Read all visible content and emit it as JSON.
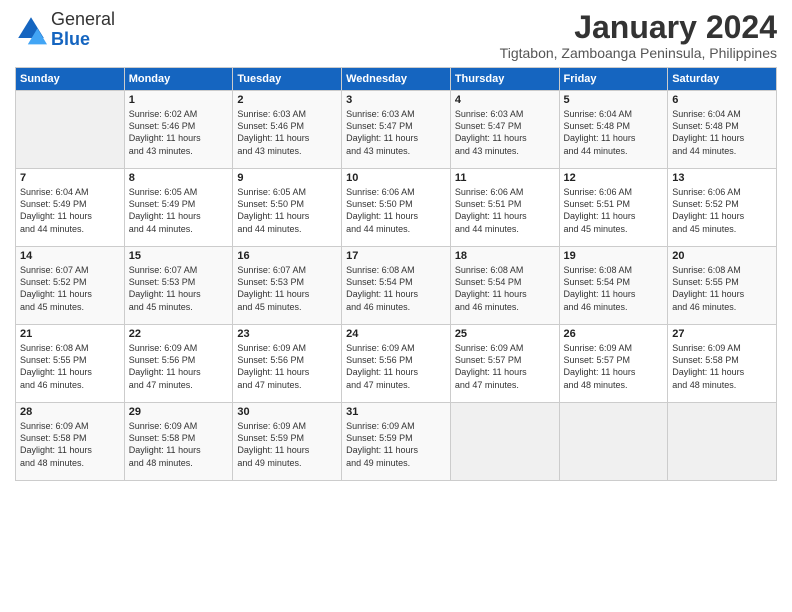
{
  "logo": {
    "line1": "General",
    "line2": "Blue"
  },
  "title": "January 2024",
  "subtitle": "Tigtabon, Zamboanga Peninsula, Philippines",
  "days_header": [
    "Sunday",
    "Monday",
    "Tuesday",
    "Wednesday",
    "Thursday",
    "Friday",
    "Saturday"
  ],
  "weeks": [
    [
      {
        "day": "",
        "info": ""
      },
      {
        "day": "1",
        "info": "Sunrise: 6:02 AM\nSunset: 5:46 PM\nDaylight: 11 hours\nand 43 minutes."
      },
      {
        "day": "2",
        "info": "Sunrise: 6:03 AM\nSunset: 5:46 PM\nDaylight: 11 hours\nand 43 minutes."
      },
      {
        "day": "3",
        "info": "Sunrise: 6:03 AM\nSunset: 5:47 PM\nDaylight: 11 hours\nand 43 minutes."
      },
      {
        "day": "4",
        "info": "Sunrise: 6:03 AM\nSunset: 5:47 PM\nDaylight: 11 hours\nand 43 minutes."
      },
      {
        "day": "5",
        "info": "Sunrise: 6:04 AM\nSunset: 5:48 PM\nDaylight: 11 hours\nand 44 minutes."
      },
      {
        "day": "6",
        "info": "Sunrise: 6:04 AM\nSunset: 5:48 PM\nDaylight: 11 hours\nand 44 minutes."
      }
    ],
    [
      {
        "day": "7",
        "info": "Sunrise: 6:04 AM\nSunset: 5:49 PM\nDaylight: 11 hours\nand 44 minutes."
      },
      {
        "day": "8",
        "info": "Sunrise: 6:05 AM\nSunset: 5:49 PM\nDaylight: 11 hours\nand 44 minutes."
      },
      {
        "day": "9",
        "info": "Sunrise: 6:05 AM\nSunset: 5:50 PM\nDaylight: 11 hours\nand 44 minutes."
      },
      {
        "day": "10",
        "info": "Sunrise: 6:06 AM\nSunset: 5:50 PM\nDaylight: 11 hours\nand 44 minutes."
      },
      {
        "day": "11",
        "info": "Sunrise: 6:06 AM\nSunset: 5:51 PM\nDaylight: 11 hours\nand 44 minutes."
      },
      {
        "day": "12",
        "info": "Sunrise: 6:06 AM\nSunset: 5:51 PM\nDaylight: 11 hours\nand 45 minutes."
      },
      {
        "day": "13",
        "info": "Sunrise: 6:06 AM\nSunset: 5:52 PM\nDaylight: 11 hours\nand 45 minutes."
      }
    ],
    [
      {
        "day": "14",
        "info": "Sunrise: 6:07 AM\nSunset: 5:52 PM\nDaylight: 11 hours\nand 45 minutes."
      },
      {
        "day": "15",
        "info": "Sunrise: 6:07 AM\nSunset: 5:53 PM\nDaylight: 11 hours\nand 45 minutes."
      },
      {
        "day": "16",
        "info": "Sunrise: 6:07 AM\nSunset: 5:53 PM\nDaylight: 11 hours\nand 45 minutes."
      },
      {
        "day": "17",
        "info": "Sunrise: 6:08 AM\nSunset: 5:54 PM\nDaylight: 11 hours\nand 46 minutes."
      },
      {
        "day": "18",
        "info": "Sunrise: 6:08 AM\nSunset: 5:54 PM\nDaylight: 11 hours\nand 46 minutes."
      },
      {
        "day": "19",
        "info": "Sunrise: 6:08 AM\nSunset: 5:54 PM\nDaylight: 11 hours\nand 46 minutes."
      },
      {
        "day": "20",
        "info": "Sunrise: 6:08 AM\nSunset: 5:55 PM\nDaylight: 11 hours\nand 46 minutes."
      }
    ],
    [
      {
        "day": "21",
        "info": "Sunrise: 6:08 AM\nSunset: 5:55 PM\nDaylight: 11 hours\nand 46 minutes."
      },
      {
        "day": "22",
        "info": "Sunrise: 6:09 AM\nSunset: 5:56 PM\nDaylight: 11 hours\nand 47 minutes."
      },
      {
        "day": "23",
        "info": "Sunrise: 6:09 AM\nSunset: 5:56 PM\nDaylight: 11 hours\nand 47 minutes."
      },
      {
        "day": "24",
        "info": "Sunrise: 6:09 AM\nSunset: 5:56 PM\nDaylight: 11 hours\nand 47 minutes."
      },
      {
        "day": "25",
        "info": "Sunrise: 6:09 AM\nSunset: 5:57 PM\nDaylight: 11 hours\nand 47 minutes."
      },
      {
        "day": "26",
        "info": "Sunrise: 6:09 AM\nSunset: 5:57 PM\nDaylight: 11 hours\nand 48 minutes."
      },
      {
        "day": "27",
        "info": "Sunrise: 6:09 AM\nSunset: 5:58 PM\nDaylight: 11 hours\nand 48 minutes."
      }
    ],
    [
      {
        "day": "28",
        "info": "Sunrise: 6:09 AM\nSunset: 5:58 PM\nDaylight: 11 hours\nand 48 minutes."
      },
      {
        "day": "29",
        "info": "Sunrise: 6:09 AM\nSunset: 5:58 PM\nDaylight: 11 hours\nand 48 minutes."
      },
      {
        "day": "30",
        "info": "Sunrise: 6:09 AM\nSunset: 5:59 PM\nDaylight: 11 hours\nand 49 minutes."
      },
      {
        "day": "31",
        "info": "Sunrise: 6:09 AM\nSunset: 5:59 PM\nDaylight: 11 hours\nand 49 minutes."
      },
      {
        "day": "",
        "info": ""
      },
      {
        "day": "",
        "info": ""
      },
      {
        "day": "",
        "info": ""
      }
    ]
  ]
}
